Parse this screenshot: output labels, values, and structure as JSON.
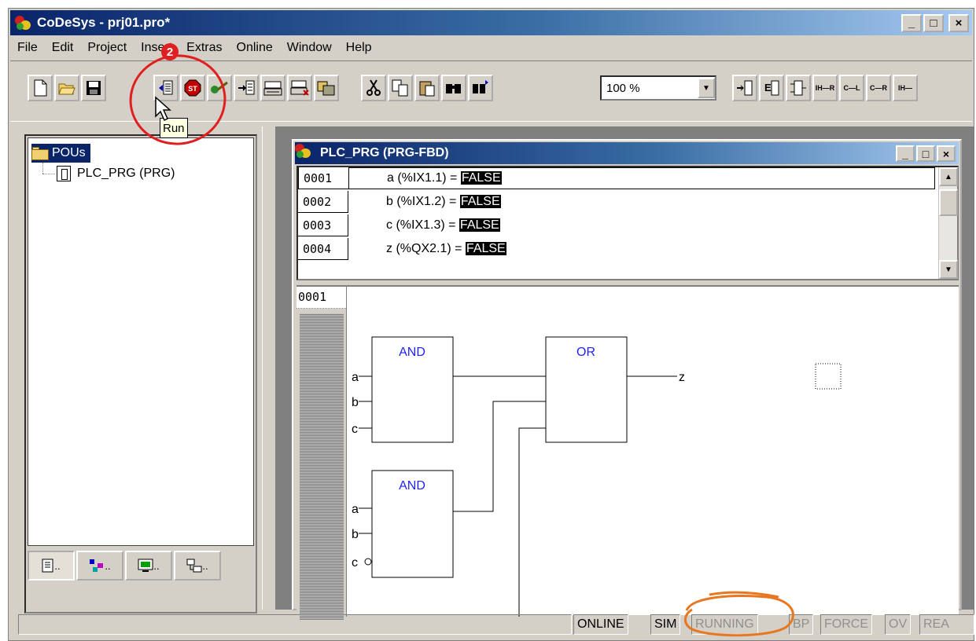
{
  "window": {
    "title": "CoDeSys - prj01.pro*",
    "buttons": {
      "minimize": "_",
      "maximize": "□",
      "close": "×"
    }
  },
  "menu": [
    "File",
    "Edit",
    "Project",
    "Insert",
    "Extras",
    "Online",
    "Window",
    "Help"
  ],
  "toolbar": {
    "zoom": "100 %",
    "tooltip": "Run",
    "annotation_badge": "2",
    "fbd_buttons": [
      "IH—R",
      "C—L",
      "C—R",
      "IH—"
    ]
  },
  "project_tree": {
    "root": "POUs",
    "items": [
      "PLC_PRG (PRG)"
    ],
    "tab_suffix": ".."
  },
  "editor": {
    "title": "PLC_PRG (PRG-FBD)",
    "declarations": [
      {
        "line": "0001",
        "text": "a (%IX1.1) = ",
        "value": "FALSE"
      },
      {
        "line": "0002",
        "text": "b (%IX1.2) = ",
        "value": "FALSE"
      },
      {
        "line": "0003",
        "text": "c (%IX1.3) = ",
        "value": "FALSE"
      },
      {
        "line": "0004",
        "text": "z (%QX2.1) = ",
        "value": "FALSE"
      }
    ],
    "network_number": "0001",
    "fbd": {
      "block1": {
        "type": "AND",
        "inputs": [
          "a",
          "b",
          "c"
        ]
      },
      "block2": {
        "type": "OR",
        "output": "z"
      },
      "block3": {
        "type": "AND",
        "inputs": [
          "a",
          "b",
          "c"
        ]
      }
    }
  },
  "status": {
    "online": "ONLINE",
    "sim": "SIM",
    "running": "RUNNING",
    "bp": "BP",
    "force": "FORCE",
    "ov": "OV",
    "read": "REA"
  },
  "colors": {
    "title_active": "#0a246a",
    "fbd_block_label": "#1f1fff",
    "annotation_red": "#e02020",
    "annotation_orange": "#e87722"
  }
}
